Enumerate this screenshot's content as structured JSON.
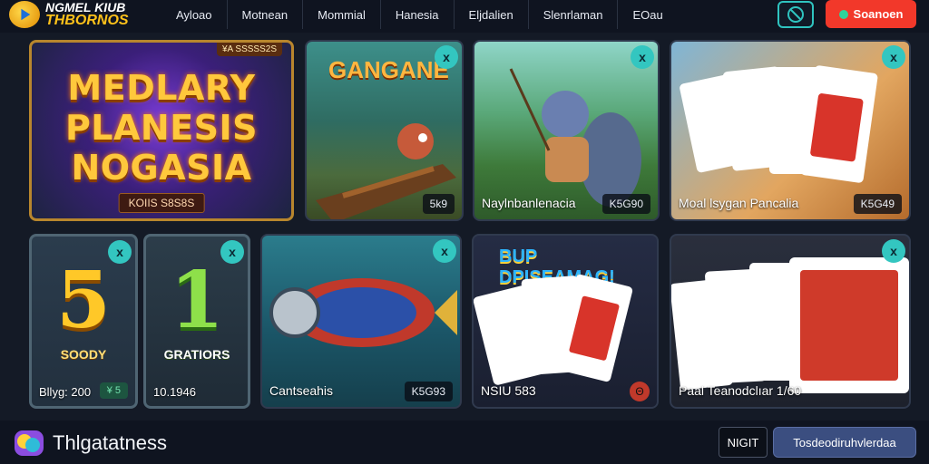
{
  "header": {
    "logo_line1": "NGMEL KIUB",
    "logo_line2": "THBORNOS",
    "nav": [
      "Ayloao",
      "Motnean",
      "Mommial",
      "Hanesia",
      "Eljdalien",
      "Slenrlaman",
      "EOau"
    ],
    "cta_label": "Soanoen"
  },
  "tiles": {
    "hero": {
      "tag": "¥A SSSSS2S",
      "title": "MEDLARY PLANESIS NOGASIA",
      "badge": "KOIIS S8S8S"
    },
    "canoe": {
      "headline": "GANGANE",
      "value": "5k9"
    },
    "fisher": {
      "caption": "Naylnbanlenacia",
      "value": "K5G90"
    },
    "cards": {
      "caption": "Moal lsygan Pancalia",
      "value": "K5G49"
    },
    "five": {
      "number": "5",
      "label": "SOODY",
      "caption": "Bllyg: 200",
      "value": "¥ 5"
    },
    "one": {
      "number": "1",
      "label": "GRATIORS",
      "caption": "10.1946"
    },
    "can": {
      "caption": "Cantseahis",
      "value": "K5G93"
    },
    "royal": {
      "headline": "BUP DPISEAMAG!",
      "caption": "NSIU 583",
      "value": "Θ"
    },
    "pack": {
      "caption": "Paal Teanodclıar 1/60"
    }
  },
  "footer": {
    "brand": "Thlgatatness",
    "night_label": "NIGIT",
    "primary_label": "Tosdeodiruhvlerdaa"
  },
  "colors": {
    "accent": "#33c6c0",
    "cta": "#f2382a",
    "gold": "#ffc83c",
    "primary_button": "#3b4e80"
  }
}
